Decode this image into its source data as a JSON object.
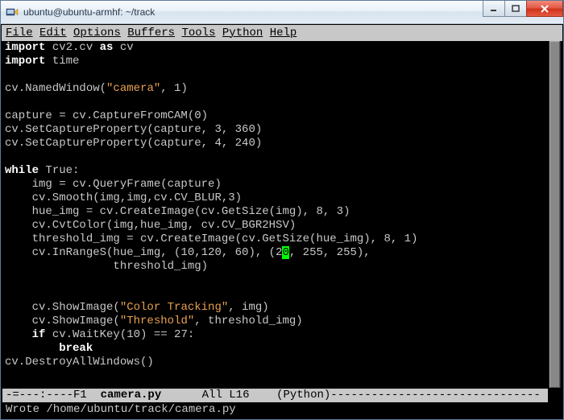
{
  "window": {
    "title": "ubuntu@ubuntu-armhf: ~/track"
  },
  "menubar": {
    "file": "File",
    "edit": "Edit",
    "options": "Options",
    "buffers": "Buffers",
    "tools": "Tools",
    "python": "Python",
    "help": "Help"
  },
  "code": {
    "l1a": "import",
    "l1b": " cv2.cv ",
    "l1c": "as",
    "l1d": " cv",
    "l2a": "import",
    "l2b": " time",
    "l4": "cv.NamedWindow(",
    "l4s": "\"camera\"",
    "l4e": ", 1)",
    "l6": "capture = cv.CaptureFromCAM(0)",
    "l7": "cv.SetCaptureProperty(capture, 3, 360)",
    "l8": "cv.SetCaptureProperty(capture, 4, 240)",
    "l10a": "while",
    "l10b": " True:",
    "l11": "    img = cv.QueryFrame(capture)",
    "l12": "    cv.Smooth(img,img,cv.CV_BLUR,3)",
    "l13": "    hue_img = cv.CreateImage(cv.GetSize(img), 8, 3)",
    "l14": "    cv.CvtColor(img,hue_img, cv.CV_BGR2HSV)",
    "l15": "    threshold_img = cv.CreateImage(cv.GetSize(hue_img), 8, 1)",
    "l16a": "    cv.InRangeS(hue_img, (10,120, 60), (2",
    "l16cur": "0",
    "l16b": ", 255, 255),",
    "l17": "                threshold_img)",
    "l20a": "    cv.ShowImage(",
    "l20s": "\"Color Tracking\"",
    "l20e": ", img)",
    "l21a": "    cv.ShowImage(",
    "l21s": "\"Threshold\"",
    "l21e": ", threshold_img)",
    "l22a": "    ",
    "l22b": "if",
    "l22c": " cv.WaitKey(10) == 27:",
    "l23a": "        ",
    "l23b": "break",
    "l24": "cv.DestroyAllWindows()"
  },
  "modeline": {
    "left": "-=---:----F1  ",
    "filename": "camera.py",
    "mid": "      All L16    (Python)",
    "dashes": "-------------------------------"
  },
  "minibuffer": {
    "text": "Wrote /home/ubuntu/track/camera.py"
  }
}
